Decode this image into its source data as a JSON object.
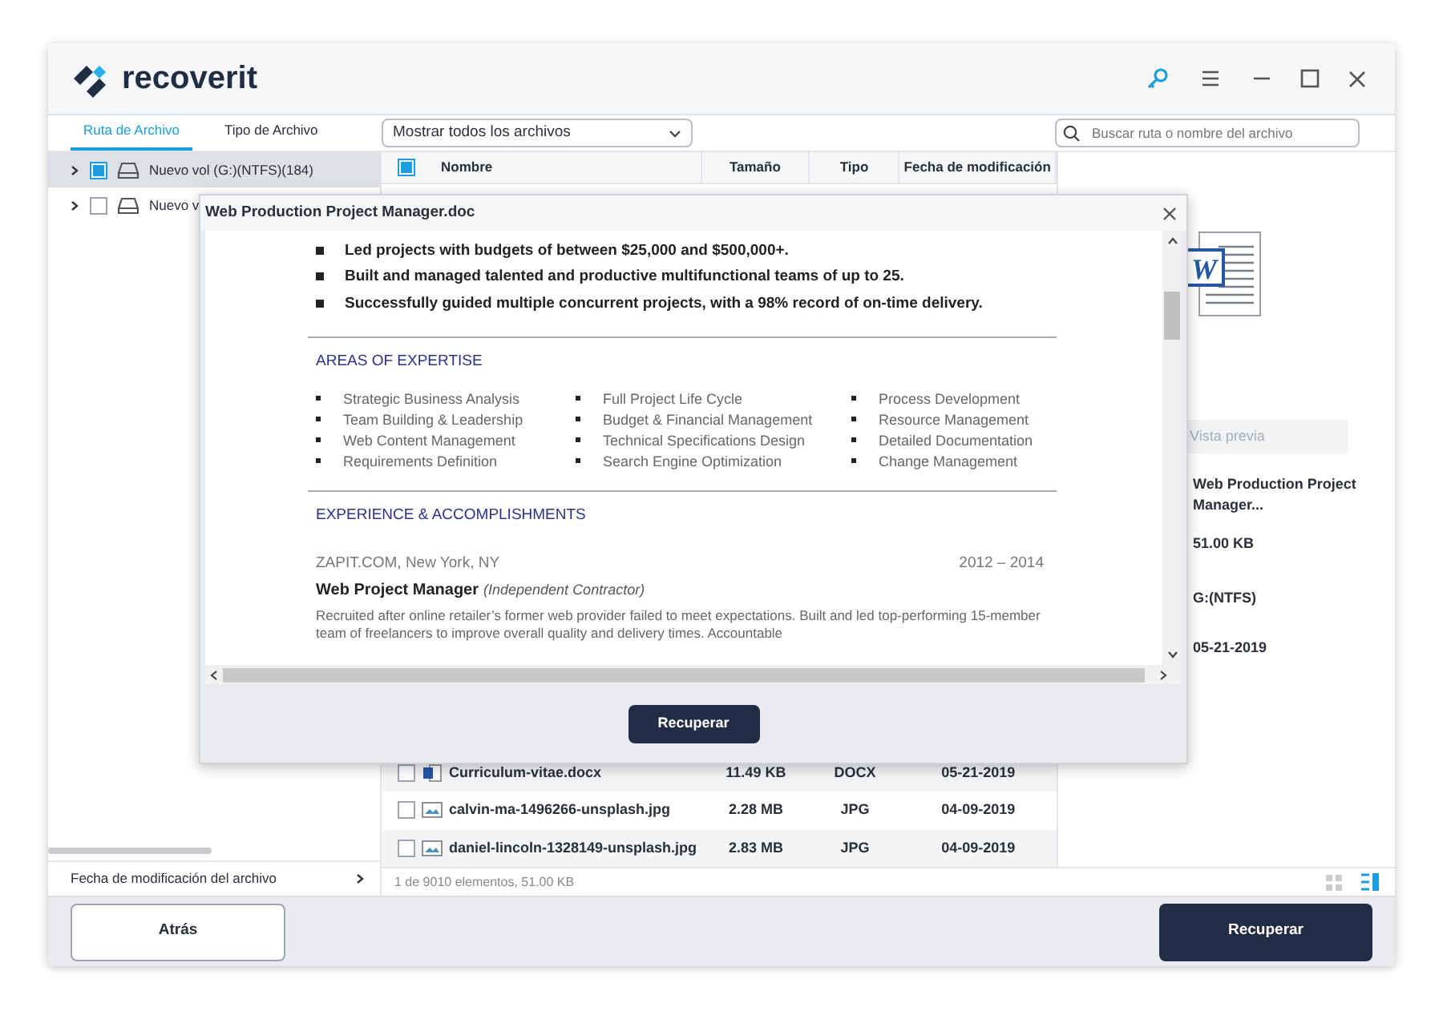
{
  "app": {
    "logo_text": "recoverit"
  },
  "filter_tabs": [
    {
      "label": "Ruta de Archivo",
      "selected": true
    },
    {
      "label": "Tipo de Archivo",
      "selected": false
    }
  ],
  "file_filter": {
    "value": "Mostrar todos los archivos"
  },
  "search": {
    "placeholder": "Buscar ruta o nombre del archivo"
  },
  "tree": [
    {
      "label": "Nuevo vol (G:)(NTFS)(184)",
      "selected": true,
      "checked": true
    },
    {
      "label": "Nuevo v",
      "selected": false,
      "checked": false
    }
  ],
  "sidebar_footer": "Fecha de modificación del archivo",
  "table": {
    "header_checked": true,
    "columns": [
      "Nombre",
      "Tamaño",
      "Tipo",
      "Fecha de modificación"
    ],
    "rows": [
      {
        "name": "Curriculum-vitae.docx",
        "size": "11.49  KB",
        "type": "DOCX",
        "date": "05-21-2019",
        "kind": "document",
        "checked": false
      },
      {
        "name": "calvin-ma-1496266-unsplash.jpg",
        "size": "2.28  MB",
        "type": "JPG",
        "date": "04-09-2019",
        "kind": "image",
        "checked": false
      },
      {
        "name": "daniel-lincoln-1328149-unsplash.jpg",
        "size": "2.83  MB",
        "type": "JPG",
        "date": "04-09-2019",
        "kind": "image",
        "checked": false
      }
    ]
  },
  "status": "1 de 9010 elementos, 51.00  KB",
  "view_modes": [
    {
      "kind": "grid",
      "selected": false
    },
    {
      "kind": "list",
      "selected": true
    }
  ],
  "preview": {
    "icon_letter": "W",
    "button": "Vista previa",
    "name": "Web Production Project Manager...",
    "size": "51.00  KB",
    "location": "G:(NTFS)",
    "date": "05-21-2019"
  },
  "buttons": {
    "back": "Atrás",
    "recover": "Recuperar"
  },
  "dialog": {
    "title": "Web Production Project Manager.doc",
    "recover_button": "Recuperar",
    "document": {
      "highlights": [
        "Led projects with budgets of between $25,000 and $500,000+.",
        "Built and managed talented and productive multifunctional teams of up to 25.",
        "Successfully guided multiple concurrent projects, with a 98% record of on-time delivery."
      ],
      "sections": [
        {
          "kind": "skills",
          "heading": "AREAS OF EXPERTISE",
          "items": [
            "Strategic Business Analysis",
            "Full Project Life Cycle",
            "Process Development",
            "Team Building & Leadership",
            "Budget & Financial Management",
            "Resource Management",
            "Web Content Management",
            "Technical Specifications Design",
            "Detailed Documentation",
            "Requirements Definition",
            "Search Engine Optimization",
            "Change Management"
          ]
        },
        {
          "kind": "job",
          "heading": "EXPERIENCE & ACCOMPLISHMENTS",
          "company": "ZAPIT.COM, New York, NY",
          "dates": "2012 – 2014",
          "role": "Web Project Manager",
          "role_note": "(Independent Contractor)",
          "description": "Recruited after online retailer’s former web provider failed to meet expectations. Built and led top-performing 15-member team of freelancers to improve overall quality and delivery times. Accountable"
        }
      ]
    }
  }
}
